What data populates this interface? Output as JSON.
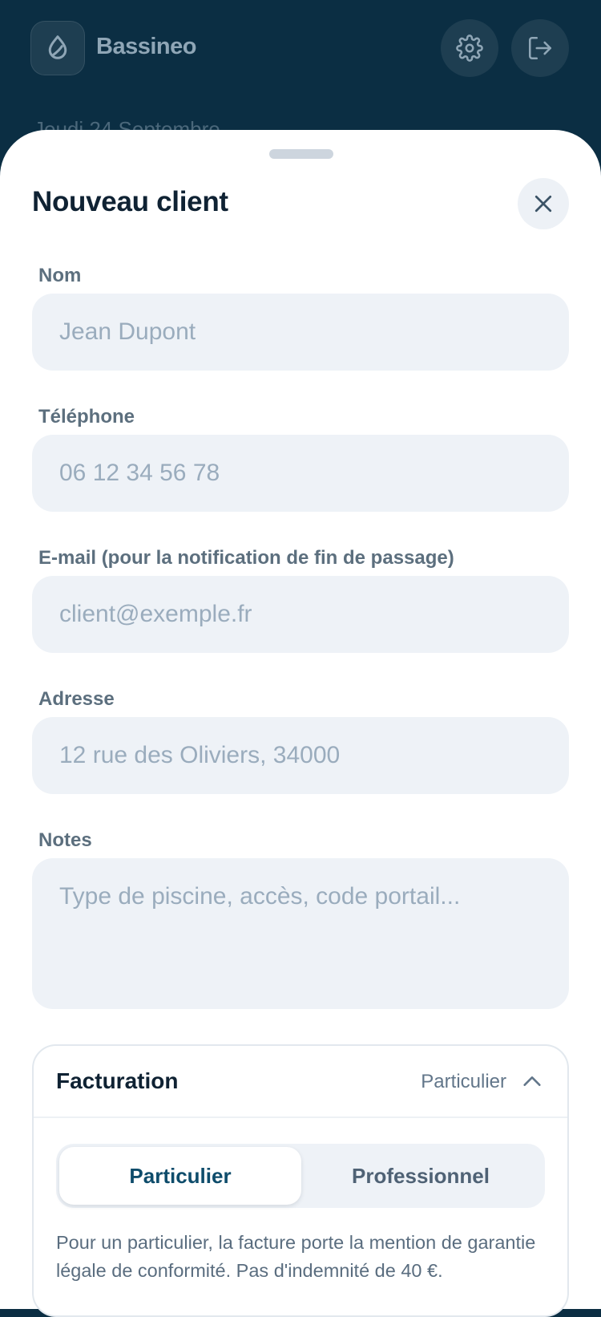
{
  "header": {
    "app_name": "Bassineo",
    "date_peek": "Jeudi 24 Septembre",
    "icons": [
      "water-drop-icon",
      "gear-icon",
      "logout-icon"
    ]
  },
  "sheet": {
    "title": "Nouveau client",
    "fields": {
      "name": {
        "label": "Nom",
        "placeholder": "Jean Dupont",
        "value": ""
      },
      "phone": {
        "label": "Téléphone",
        "placeholder": "06 12 34 56 78",
        "value": ""
      },
      "email": {
        "label": "E-mail (pour la notification de fin de passage)",
        "placeholder": "client@exemple.fr",
        "value": ""
      },
      "address": {
        "label": "Adresse",
        "placeholder": "12 rue des Oliviers, 34000",
        "value": ""
      },
      "notes": {
        "label": "Notes",
        "placeholder": "Type de piscine, accès, code portail...",
        "value": ""
      }
    },
    "billing": {
      "title": "Facturation",
      "selected": "Particulier",
      "options": [
        "Particulier",
        "Professionnel"
      ],
      "note": "Pour un particulier, la facture porte la mention de garantie légale de conformité. Pas d'indemnité de 40 €."
    }
  },
  "colors": {
    "header_bg": "#0b2e43",
    "input_bg": "#eef2f7",
    "accent": "#0e4c6b"
  }
}
